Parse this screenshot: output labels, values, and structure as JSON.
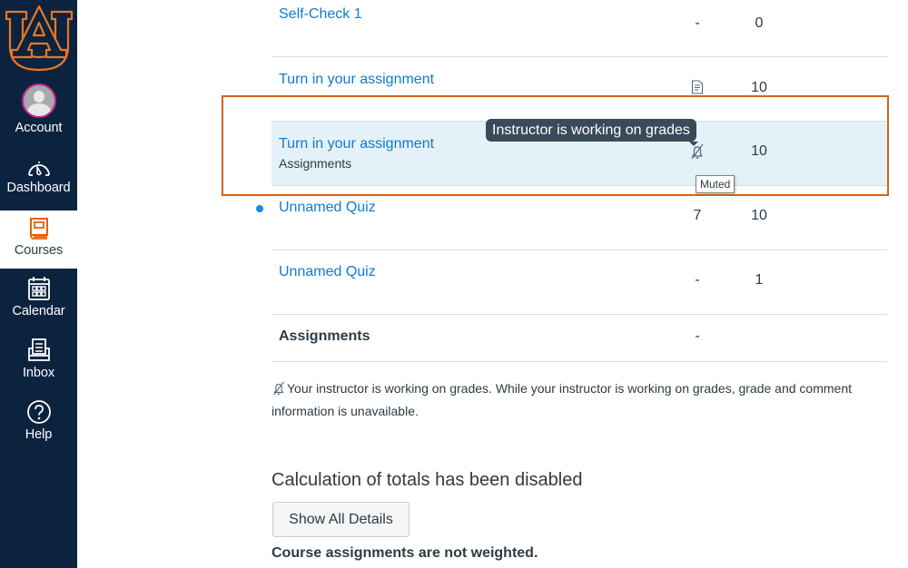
{
  "nav": {
    "items": [
      {
        "label": "Account",
        "icon": "avatar"
      },
      {
        "label": "Dashboard",
        "icon": "dashboard-gauge-icon"
      },
      {
        "label": "Courses",
        "icon": "book-icon",
        "active": true
      },
      {
        "label": "Calendar",
        "icon": "calendar-icon"
      },
      {
        "label": "Inbox",
        "icon": "inbox-icon"
      },
      {
        "label": "Help",
        "icon": "help-question-icon"
      }
    ],
    "brand_color": "#0c2340",
    "accent_color": "#e87722"
  },
  "grades": {
    "rows": [
      {
        "title": "Self-Check 1",
        "score": "-",
        "out_of": "0"
      },
      {
        "title": "Turn in your assignment",
        "score_icon": "document-icon",
        "out_of": "10"
      },
      {
        "title": "Turn in your assignment",
        "subtitle": "Assignments",
        "score_icon": "muted-bell-icon",
        "out_of": "10",
        "highlighted": true
      },
      {
        "title": "Unnamed Quiz",
        "score": "7",
        "out_of": "10",
        "unread": true
      },
      {
        "title": "Unnamed Quiz",
        "score": "-",
        "out_of": "1"
      }
    ],
    "group_total": {
      "title": "Assignments",
      "score": "-"
    }
  },
  "tooltips": {
    "instructor": "Instructor is working on grades",
    "muted": "Muted"
  },
  "muted_note": "Your instructor is working on grades. While your instructor is working on grades, grade and comment information is unavailable.",
  "totals": {
    "heading": "Calculation of totals has been disabled",
    "show_all_button": "Show All Details",
    "weighting_note": "Course assignments are not weighted."
  },
  "colors": {
    "link": "#0e7bd1",
    "highlight_row": "#e5f1f8",
    "annotation_border": "#d4631e"
  }
}
